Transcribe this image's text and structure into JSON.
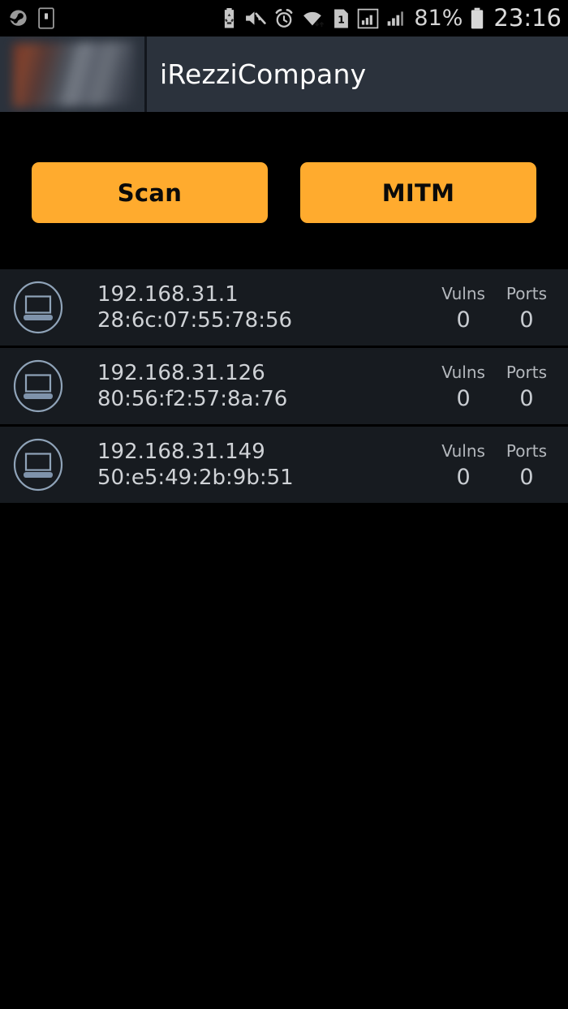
{
  "status_bar": {
    "left_icons": [
      {
        "name": "steam-icon",
        "glyph": "steam"
      },
      {
        "name": "sim-card-icon",
        "glyph": "sim"
      }
    ],
    "right_icons": [
      {
        "name": "battery-saver-icon",
        "glyph": "recycle-battery"
      },
      {
        "name": "mute-icon",
        "glyph": "speaker-muted"
      },
      {
        "name": "alarm-icon",
        "glyph": "alarm-clock"
      },
      {
        "name": "wifi-icon",
        "glyph": "wifi-transfer"
      },
      {
        "name": "sim-slot-1-icon",
        "glyph": "sim-1"
      },
      {
        "name": "signal-boxed-icon",
        "glyph": "signal-bars-boxed"
      },
      {
        "name": "signal-icon",
        "glyph": "signal-bars"
      }
    ],
    "battery_percent": "81%",
    "battery_icon": "battery-full-icon",
    "clock": "23:16"
  },
  "header": {
    "logo_alt": "company-logo",
    "title": "iRezziCompany"
  },
  "actions": {
    "scan_label": "Scan",
    "mitm_label": "MITM",
    "accent_color": "#ffab2e",
    "accent_text_color": "#0a0a0a"
  },
  "device_list": {
    "stat_labels": {
      "vulns": "Vulns",
      "ports": "Ports"
    },
    "rows": [
      {
        "icon": "laptop-icon",
        "ip": "192.168.31.1",
        "mac": "28:6c:07:55:78:56",
        "vulns": "0",
        "ports": "0"
      },
      {
        "icon": "laptop-icon",
        "ip": "192.168.31.126",
        "mac": "80:56:f2:57:8a:76",
        "vulns": "0",
        "ports": "0"
      },
      {
        "icon": "laptop-icon",
        "ip": "192.168.31.149",
        "mac": "50:e5:49:2b:9b:51",
        "vulns": "0",
        "ports": "0"
      }
    ]
  },
  "colors": {
    "background": "#000000",
    "header_bg": "#2b323c",
    "row_bg": "#171b20",
    "text_primary": "#cfd2d6",
    "icon_stroke": "#9fb0c4"
  }
}
